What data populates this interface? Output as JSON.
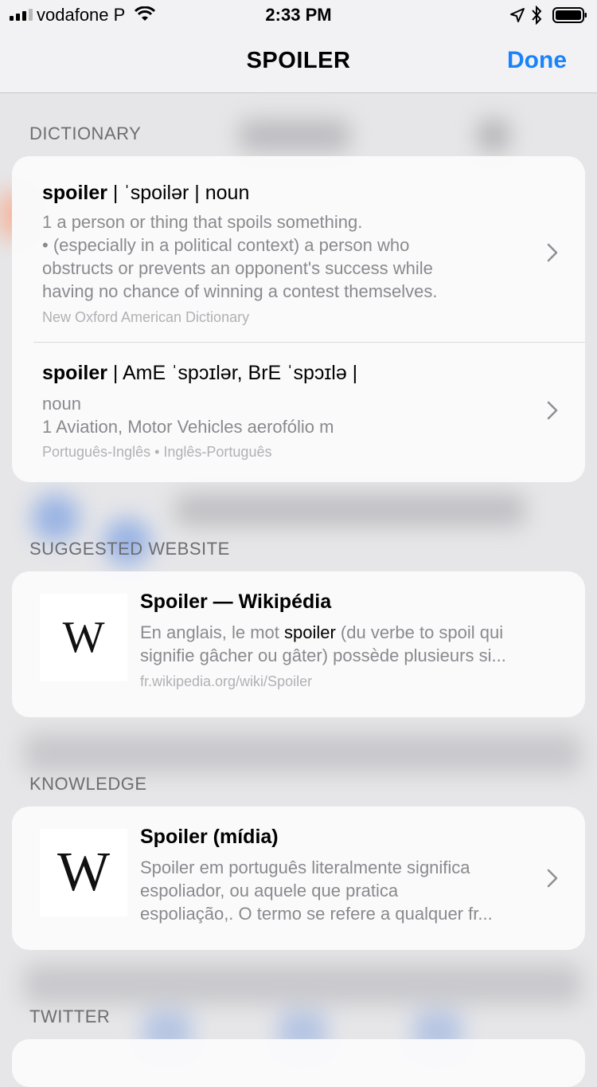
{
  "status_bar": {
    "carrier": "vodafone P",
    "time": "2:33 PM"
  },
  "nav": {
    "title": "SPOILER",
    "done_label": "Done"
  },
  "sections": {
    "dictionary": "DICTIONARY",
    "suggested_website": "SUGGESTED WEBSITE",
    "knowledge": "KNOWLEDGE",
    "twitter": "TWITTER"
  },
  "dictionary": [
    {
      "headword": "spoiler",
      "rest": " | ˈspoilər | noun",
      "lines": [
        "1 a person or thing that spoils something.",
        "• (especially in a political context) a person who",
        "obstructs or prevents an opponent's success while",
        "having no chance of winning a contest themselves."
      ],
      "source": "New Oxford American Dictionary"
    },
    {
      "headword": "spoiler",
      "rest": " | AmE ˈspɔɪlər, BrE ˈspɔɪlə |",
      "lines": [
        "noun",
        "1 Aviation, Motor Vehicles aerofólio m"
      ],
      "source": "Português-Inglês • Inglês-Português"
    }
  ],
  "suggested_website": {
    "logo": "W",
    "title": "Spoiler — Wikipédia",
    "line1_before": "En anglais, le mot ",
    "line1_highlight": "spoiler",
    "line1_after": " (du verbe to spoil qui",
    "line2": "signifie gâcher ou gâter) possède plusieurs si...",
    "url": "fr.wikipedia.org/wiki/Spoiler"
  },
  "knowledge": {
    "logo": "W",
    "title": "Spoiler (mídia)",
    "lines": [
      "Spoiler em português literalmente significa",
      "espoliador, ou aquele que pratica",
      "espoliação,. O termo se refere a qualquer fr..."
    ]
  },
  "colors": {
    "accent": "#1a82fb",
    "secondary_text": "#8a8a8e",
    "source_text": "#b1b1b5"
  }
}
